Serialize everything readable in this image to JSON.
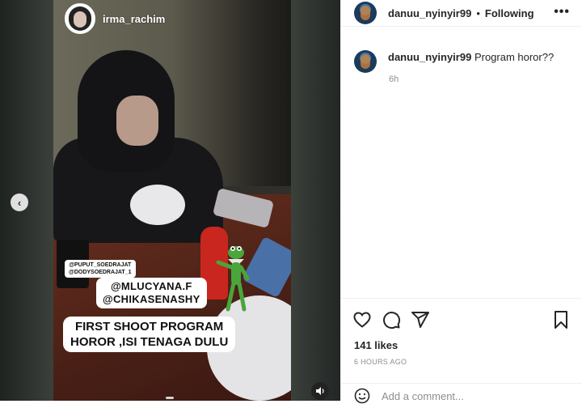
{
  "story": {
    "username": "irma_rachim",
    "stickers": {
      "tag_line1": "@PUPUT_SOEDRAJAT",
      "tag_line2": "@DODYSOEDRAJAT_1",
      "mention_line1": "@MLUCYANA.F",
      "mention_line2": "@CHIKASENASHY",
      "caption_line1": "FIRST SHOOT PROGRAM",
      "caption_line2": "HOROR ,ISI TENAGA DULU"
    }
  },
  "panel": {
    "header": {
      "username": "danuu_nyinyir99",
      "separator": "•",
      "follow_status": "Following",
      "more": "•••"
    },
    "comment": {
      "username": "danuu_nyinyir99",
      "text": "Program horor??",
      "time": "6h"
    },
    "likes": "141 likes",
    "posted_ago": "6 HOURS AGO",
    "add_comment_placeholder": "Add a comment..."
  },
  "colors": {
    "text": "#262626",
    "muted": "#8e8e8e",
    "divider": "#efefef"
  }
}
